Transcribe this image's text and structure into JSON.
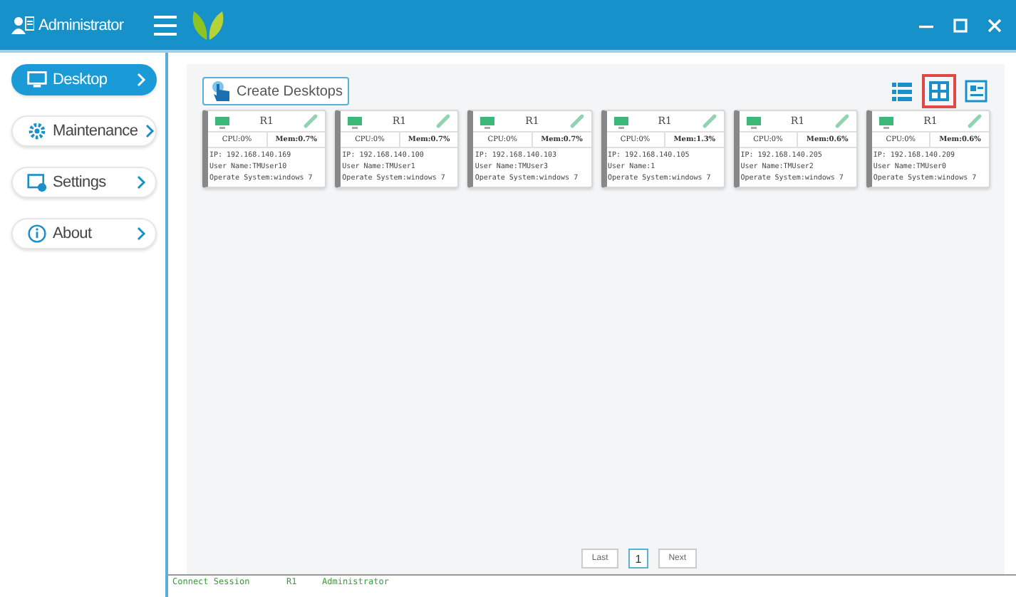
{
  "header": {
    "user": "Administrator"
  },
  "sidebar": {
    "items": [
      {
        "label": "Desktop",
        "kind": "desktop",
        "selected": true
      },
      {
        "label": "Maintenance",
        "kind": "maintenance",
        "selected": false
      },
      {
        "label": "Settings",
        "kind": "settings",
        "selected": false
      },
      {
        "label": "About",
        "kind": "about",
        "selected": false
      }
    ]
  },
  "toolbar": {
    "create_button": "Create Desktops",
    "views": [
      {
        "kind": "list",
        "selected": false
      },
      {
        "kind": "grid",
        "selected": true
      },
      {
        "kind": "card",
        "selected": false
      }
    ]
  },
  "desktops": [
    {
      "name": "R1",
      "cpu": "CPU:0%",
      "mem": "Mem:0.7%",
      "ip": "IP: 192.168.140.169",
      "user": "User Name:TMUser10",
      "os": "Operate System:windows 7"
    },
    {
      "name": "R1",
      "cpu": "CPU:0%",
      "mem": "Mem:0.7%",
      "ip": "IP: 192.168.140.100",
      "user": "User Name:TMUser1",
      "os": "Operate System:windows 7"
    },
    {
      "name": "R1",
      "cpu": "CPU:0%",
      "mem": "Mem:0.7%",
      "ip": "IP: 192.168.140.103",
      "user": "User Name:TMUser3",
      "os": "Operate System:windows 7"
    },
    {
      "name": "R1",
      "cpu": "CPU:0%",
      "mem": "Mem:1.3%",
      "ip": "IP: 192.168.140.105",
      "user": "User Name:1",
      "os": "Operate System:windows 7"
    },
    {
      "name": "R1",
      "cpu": "CPU:0%",
      "mem": "Mem:0.6%",
      "ip": "IP: 192.168.140.205",
      "user": "User Name:TMUser2",
      "os": "Operate System:windows 7"
    },
    {
      "name": "R1",
      "cpu": "CPU:0%",
      "mem": "Mem:0.6%",
      "ip": "IP: 192.168.140.209",
      "user": "User Name:TMUser0",
      "os": "Operate System:windows 7"
    }
  ],
  "pagination": {
    "prev": "Last",
    "pages": [
      {
        "label": "1",
        "selected": true
      }
    ],
    "next": "Next"
  },
  "log": [
    {
      "column_1": "Connect Session",
      "column_2": "R1",
      "column_3": "Administrator"
    }
  ]
}
